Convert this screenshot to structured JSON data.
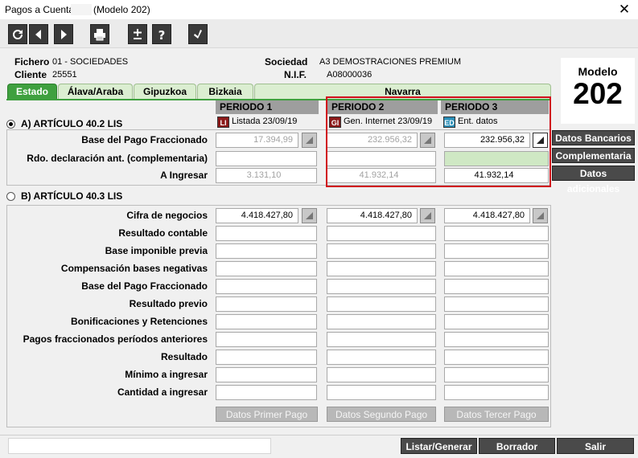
{
  "window": {
    "title": "Pagos a Cuenta",
    "title_suffix": "(Modelo 202)",
    "close_symbol": "✕"
  },
  "toolbar": {
    "buttons": [
      {
        "name": "refresh-icon"
      },
      {
        "name": "arrow-left-icon"
      },
      {
        "name": "arrow-right-icon"
      },
      {
        "name": "printer-icon"
      },
      {
        "name": "plus-minus-icon"
      },
      {
        "name": "help-icon"
      },
      {
        "name": "check-icon"
      }
    ]
  },
  "header": {
    "fichero_label": "Fichero",
    "fichero_value": "01 - SOCIEDADES",
    "cliente_label": "Cliente",
    "cliente_value": "25551",
    "sociedad_label": "Sociedad",
    "sociedad_value": "A3 DEMOSTRACIONES PREMIUM",
    "nif_label": "N.I.F.",
    "nif_value": "A08000036"
  },
  "modelo": {
    "label": "Modelo",
    "number": "202"
  },
  "tabs": [
    "Estado",
    "Álava/Araba",
    "Gipuzkoa",
    "Bizkaia",
    "Navarra"
  ],
  "periods": [
    {
      "label": "PERIODO 1",
      "badge": "LI",
      "badge_color": "#8b1a1a",
      "status": "Listada 23/09/19"
    },
    {
      "label": "PERIODO 2",
      "badge": "GI",
      "badge_color": "#8b1a1a",
      "status": "Gen. Internet 23/09/19"
    },
    {
      "label": "PERIODO 3",
      "badge": "ED",
      "badge_color": "#2a8fb8",
      "status": "Ent. datos"
    }
  ],
  "section_a": {
    "label": "A) ARTÍCULO 40.2 LIS",
    "rows": [
      {
        "label": "Base del Pago Fraccionado",
        "values": [
          "17.394,99",
          "232.956,32",
          "232.956,32"
        ]
      },
      {
        "label": "Rdo. declaración ant. (complementaria)",
        "values": [
          "",
          "",
          ""
        ]
      },
      {
        "label": "A Ingresar",
        "values": [
          "3.131,10",
          "41.932,14",
          "41.932,14"
        ]
      }
    ]
  },
  "section_b": {
    "label": "B) ARTÍCULO 40.3 LIS",
    "rows": [
      {
        "label": "Cifra de negocios",
        "values": [
          "4.418.427,80",
          "4.418.427,80",
          "4.418.427,80"
        ]
      },
      {
        "label": "Resultado contable",
        "values": [
          "",
          "",
          ""
        ]
      },
      {
        "label": "Base imponible previa",
        "values": [
          "",
          "",
          ""
        ]
      },
      {
        "label": "Compensación bases negativas",
        "values": [
          "",
          "",
          ""
        ]
      },
      {
        "label": "Base del Pago Fraccionado",
        "values": [
          "",
          "",
          ""
        ]
      },
      {
        "label": "Resultado previo",
        "values": [
          "",
          "",
          ""
        ]
      },
      {
        "label": "Bonificaciones y Retenciones",
        "values": [
          "",
          "",
          ""
        ]
      },
      {
        "label": "Pagos fraccionados períodos anteriores",
        "values": [
          "",
          "",
          ""
        ]
      },
      {
        "label": "Resultado",
        "values": [
          "",
          "",
          ""
        ]
      },
      {
        "label": "Mínimo a ingresar",
        "values": [
          "",
          "",
          ""
        ]
      },
      {
        "label": "Cantidad a ingresar",
        "values": [
          "",
          "",
          ""
        ]
      }
    ],
    "buttons": [
      "Datos Primer Pago",
      "Datos Segundo Pago",
      "Datos Tercer Pago"
    ]
  },
  "side_buttons": [
    "Datos Bancarios",
    "Complementaria",
    "Datos adicionales"
  ],
  "actions": {
    "listar": "Listar/Generar",
    "borrador": "Borrador",
    "salir": "Salir"
  },
  "colors": {
    "accent_green": "#3fa03f",
    "highlight": "#d0101c",
    "dark_button": "#4a4a4a"
  }
}
